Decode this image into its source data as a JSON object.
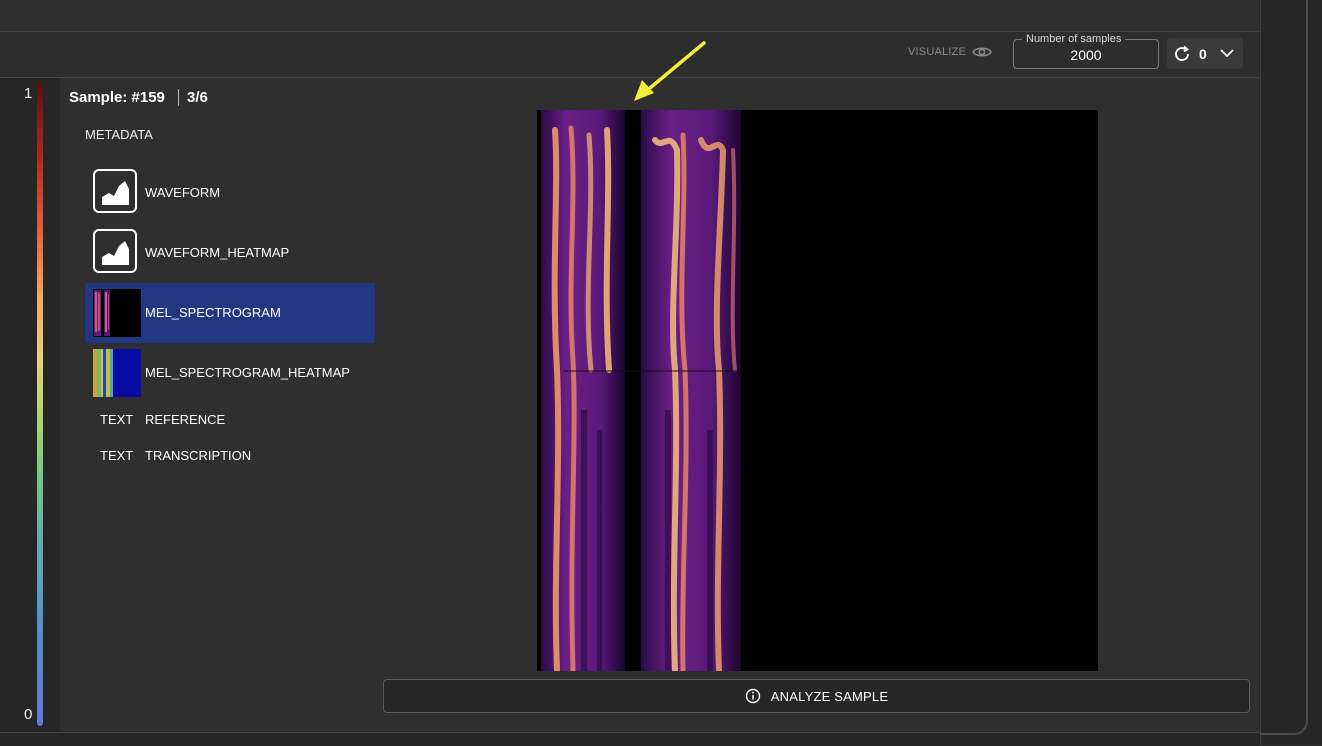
{
  "toolbar": {
    "visualize_label": "VISUALIZE",
    "samples_legend": "Number of samples",
    "samples_value": "2000",
    "refresh_count": "0"
  },
  "scale": {
    "max_label": "1",
    "min_label": "0"
  },
  "sample": {
    "title": "Sample: #159",
    "index": "3/6"
  },
  "metadata_label": "METADATA",
  "items": [
    {
      "label": "WAVEFORM",
      "icon": "area-chart-icon"
    },
    {
      "label": "WAVEFORM_HEATMAP",
      "icon": "area-chart-icon"
    },
    {
      "label": "MEL_SPECTROGRAM",
      "icon": "spectrogram-thumbnail",
      "selected": true
    },
    {
      "label": "MEL_SPECTROGRAM_HEATMAP",
      "icon": "heatmap-thumbnail"
    }
  ],
  "text_items": [
    {
      "type": "TEXT",
      "label": "REFERENCE"
    },
    {
      "type": "TEXT",
      "label": "TRANSCRIPTION"
    }
  ],
  "analyze_label": "ANALYZE SAMPLE",
  "colors": {
    "selected": "#213782",
    "arrow": "#f2ee3a",
    "background": "#2f2f2f"
  }
}
